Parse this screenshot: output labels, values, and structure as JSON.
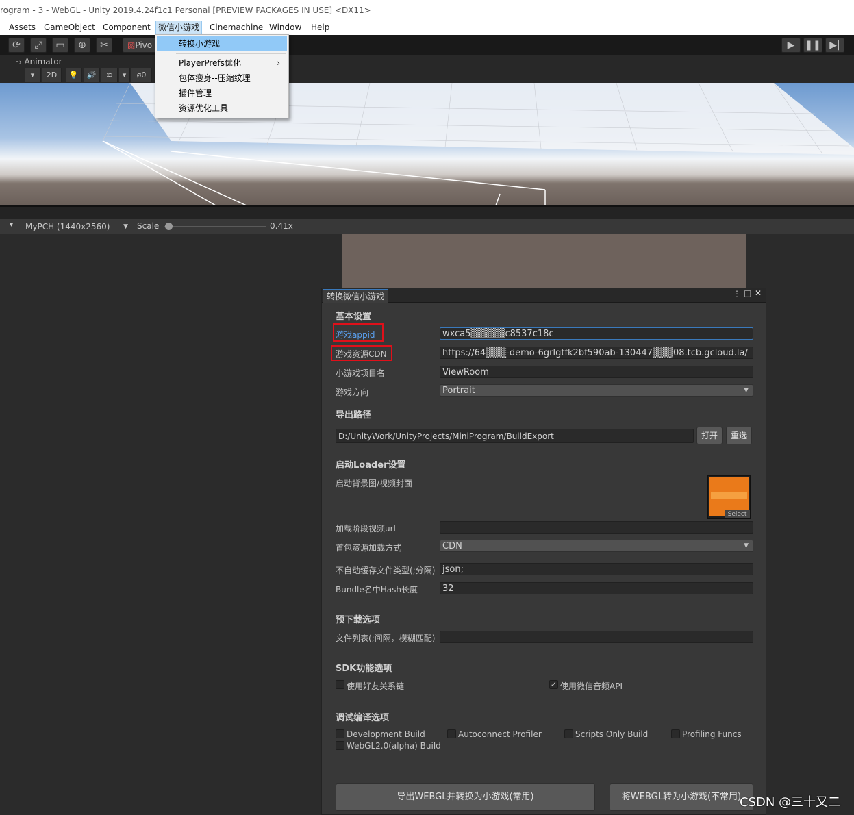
{
  "window": {
    "title": "rogram - 3 - WebGL - Unity 2019.4.24f1c1 Personal [PREVIEW PACKAGES IN USE] <DX11>"
  },
  "menubar": {
    "items": [
      "Assets",
      "GameObject",
      "Component",
      "微信小游戏",
      "Cinemachine",
      "Window",
      "Help"
    ]
  },
  "dropdown": {
    "items": [
      "转换小游戏",
      "PlayerPrefs优化",
      "包体瘦身--压缩纹理",
      "插件管理",
      "资源优化工具"
    ]
  },
  "toolbar": {
    "pivot_label": "Pivo"
  },
  "animator_tab": {
    "label": "Animator"
  },
  "scene_toolbar": {
    "mode_2d": "2D",
    "hidden_count": "0"
  },
  "game_toolbar": {
    "resolution": "MyPCH (1440x2560)",
    "scale_label": "Scale",
    "scale_value": "0.41x",
    "scale_fraction": 0.02
  },
  "panel": {
    "tab_title": "转换微信小游戏",
    "basic_title": "基本设置",
    "appid_label": "游戏appid",
    "appid_value": "wxca5▒▒▒▒▒c8537c18c",
    "cdn_label": "游戏资源CDN",
    "cdn_value": "https://64▒▒▒-demo-6grlgtfk2bf590ab-130447▒▒▒08.tcb.gcloud.la/",
    "project_label": "小游戏项目名",
    "project_value": "ViewRoom",
    "orientation_label": "游戏方向",
    "orientation_value": "Portrait",
    "export_title": "导出路径",
    "export_path": "D:/UnityWork/UnityProjects/MiniProgram/BuildExport",
    "open_button": "打开",
    "reselect_button": "重选",
    "loader_title": "启动Loader设置",
    "bg_label": "启动背景图/视频封面",
    "select_label": "Select",
    "video_label": "加载阶段视频url",
    "video_value": "",
    "load_mode_label": "首包资源加载方式",
    "load_mode_value": "CDN",
    "nocache_label": "不自动缓存文件类型(;分隔)",
    "nocache_value": "json;",
    "hash_label": "Bundle名中Hash长度",
    "hash_value": "32",
    "preload_title": "预下载选项",
    "filelist_label": "文件列表(;间隔，模糊匹配)",
    "filelist_value": "",
    "sdk_title": "SDK功能选项",
    "friend_label": "使用好友关系链",
    "friend_checked": false,
    "audio_label": "使用微信音频API",
    "audio_checked": true,
    "debug_title": "调试编译选项",
    "dev_build": "Development Build",
    "autoconnect": "Autoconnect Profiler",
    "scripts_only": "Scripts Only Build",
    "profiling": "Profiling Funcs",
    "webgl2": "WebGL2.0(alpha) Build",
    "export_button": "导出WEBGL并转换为小游戏(常用)",
    "convert_button": "将WEBGL转为小游戏(不常用)"
  },
  "watermark": "CSDN @三十又二",
  "colors": {
    "accent_blue": "#3a79bb",
    "highlight_red": "#e0101a",
    "menu_highlight": "#91c9f7"
  }
}
